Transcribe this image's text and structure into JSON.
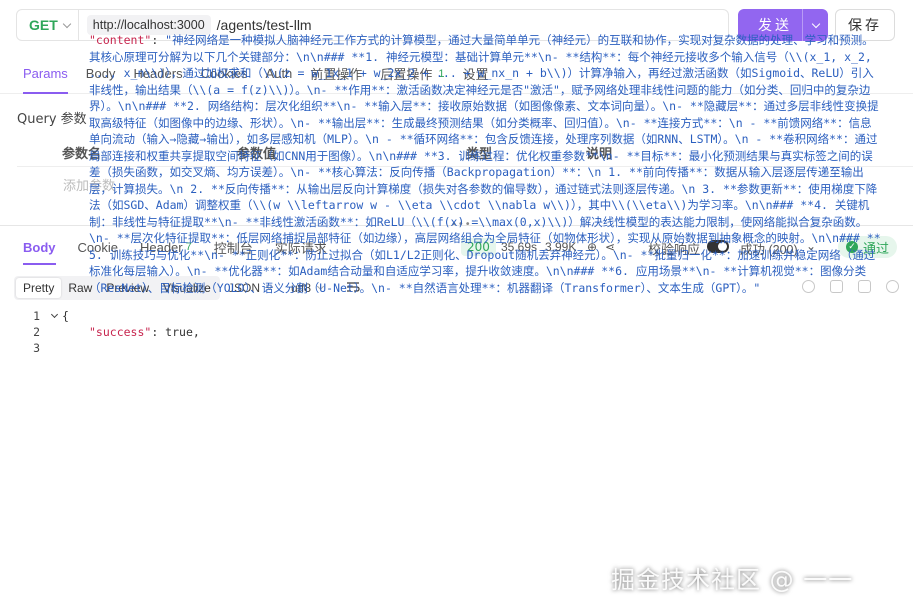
{
  "request": {
    "method": "GET",
    "host": "http://localhost:3000",
    "path": "/agents/test-llm",
    "send_label": "发送",
    "save_label": "保存"
  },
  "request_tabs": [
    {
      "label": "Params",
      "active": true
    },
    {
      "label": "Body"
    },
    {
      "label": "Headers"
    },
    {
      "label": "Cookies"
    },
    {
      "label": "Auth"
    },
    {
      "label": "前置操作"
    },
    {
      "label": "后置操作",
      "count": "1"
    },
    {
      "label": "设置"
    }
  ],
  "query": {
    "title": "Query 参数",
    "columns": [
      "参数名",
      "参数值",
      "类型",
      "说明"
    ],
    "add_placeholder": "添加参数"
  },
  "response_tabs": [
    {
      "label": "Body",
      "active": true
    },
    {
      "label": "Cookie"
    },
    {
      "label": "Header",
      "count": "7"
    },
    {
      "label": "控制台"
    },
    {
      "label": "实际请求"
    }
  ],
  "response_meta": {
    "status_code": "200",
    "time": "35.69s",
    "size": "3.99K",
    "validate_label": "校验响应",
    "result": "成功 (200)",
    "pass_label": "通过"
  },
  "view_modes": [
    "Pretty",
    "Raw",
    "Preview",
    "Visualize"
  ],
  "format": "JSON",
  "encoding": "utf8",
  "code": {
    "line_numbers": [
      "1",
      "2",
      "3"
    ],
    "open_brace": "{",
    "success_key": "\"success\"",
    "success_value": "true,",
    "content_key": "\"content\"",
    "content_value": "\"神经网络是一种模拟人脑神经元工作方式的计算模型，通过大量简单单元（神经元）的互联和协作，实现对复杂数据的处理、学习和预测。其核心原理可分解为以下几个关键部分：\\n\\n### **1. 神经元模型：基础计算单元**\\n- **结构**：每个神经元接收多个输入信号（\\\\(x_1, x_2, ..., x_n\\\\)），通过加权求和（\\\\(z = w_1x_1 + w_2x_2 + ... + w_nx_n + b\\\\)）计算净输入，再经过激活函数（如Sigmoid、ReLU）引入非线性，输出结果（\\\\(a = f(z)\\\\)）。\\n- **作用**：激活函数决定神经元是否\"激活\"，赋予网络处理非线性问题的能力（如分类、回归中的复杂边界）。\\n\\n### **2. 网络结构：层次化组织**\\n- **输入层**：接收原始数据（如图像像素、文本词向量）。\\n- **隐藏层**：通过多层非线性变换提取高级特征（如图像中的边缘、形状）。\\n- **输出层**：生成最终预测结果（如分类概率、回归值）。\\n- **连接方式**：\\n  - **前馈网络**：信息单向流动（输入→隐藏→输出），如多层感知机（MLP）。\\n  - **循环网络**：包含反馈连接，处理序列数据（如RNN、LSTM）。\\n  - **卷积网络**：通过局部连接和权重共享提取空间特征（如CNN用于图像）。\\n\\n### **3. 训练过程：优化权重参数**\\n- **目标**：最小化预测结果与真实标签之间的误差（损失函数，如交叉熵、均方误差）。\\n- **核心算法：反向传播（Backpropagation）**：\\n  1. **前向传播**：数据从输入层逐层传递至输出层，计算损失。\\n  2. **反向传播**：从输出层反向计算梯度（损失对各参数的偏导数），通过链式法则逐层传递。\\n  3. **参数更新**：使用梯度下降法（如SGD、Adam）调整权重（\\\\(w \\\\leftarrow w - \\\\eta \\\\cdot \\\\nabla w\\\\)），其中\\\\(\\\\eta\\\\)为学习率。\\n\\n### **4. 关键机制：非线性与特征提取**\\n- **非线性激活函数**：如ReLU（\\\\(f(x) =\\\\max(0,x)\\\\)）解决线性模型的表达能力限制，使网络能拟合复杂函数。\\n- **层次化特征提取**：低层网络捕捉局部特征（如边缘），高层网络组合为全局特征（如物体形状），实现从原始数据到抽象概念的映射。\\n\\n### **5. 训练技巧与优化**\\n- **正则化**：防止过拟合（如L1/L2正则化、Dropout随机丢弃神经元）。\\n- **批量归一化**：加速训练并稳定网络（通过标准化每层输入）。\\n- **优化器**：如Adam结合动量和自适应学习率，提升收敛速度。\\n\\n### **6. 应用场景**\\n- **计算机视觉**：图像分类（ResNet）、目标检测（YOLO）、语义分割（U-Net）。\\n- **自然语言处理**：机器翻译（Transformer）、文本生成（GPT）。\""
  },
  "watermark": "掘金技术社区 @ 一一"
}
